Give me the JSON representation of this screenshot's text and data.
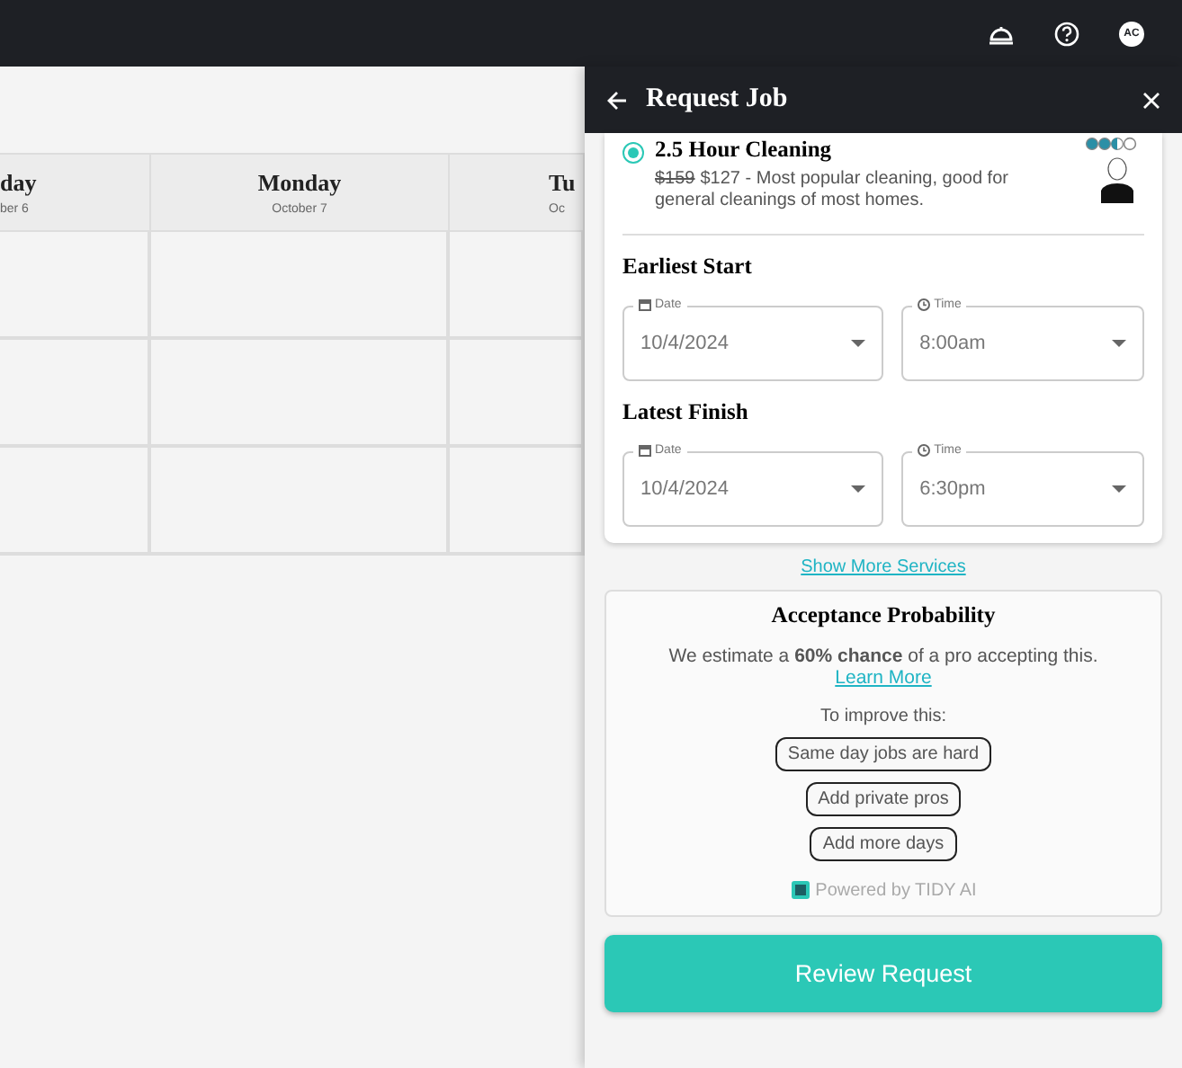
{
  "topbar": {
    "avatar": "AC"
  },
  "calendar": {
    "columns": [
      {
        "day": "day",
        "date": "ber 6"
      },
      {
        "day": "Monday",
        "date": "October 7"
      },
      {
        "day": "Tu",
        "date": "Oc"
      }
    ]
  },
  "panel": {
    "title": "Request Job",
    "service": {
      "title": "2.5 Hour Cleaning",
      "selected": true,
      "old_price": "$159",
      "description": "$127 - Most popular cleaning, good for general cleanings of most homes."
    },
    "windows": [
      {
        "title": "Earliest Start",
        "date": {
          "label": "Date",
          "value": "10/4/2024"
        },
        "time": {
          "label": "Time",
          "value": "8:00am"
        }
      },
      {
        "title": "Latest Finish",
        "date": {
          "label": "Date",
          "value": "10/4/2024"
        },
        "time": {
          "label": "Time",
          "value": "6:30pm"
        }
      }
    ],
    "more_link": "Show More Services",
    "acceptance": {
      "title": "Acceptance Probability",
      "text": "We estimate a **60% chance** of a pro accepting this.",
      "link": "Learn More",
      "improve_label": "To improve this:",
      "tips": [
        "Same day jobs are hard",
        "Add private pros",
        "Add more days"
      ],
      "powered_by": "Powered by TIDY AI"
    },
    "submit": "Review Request"
  }
}
